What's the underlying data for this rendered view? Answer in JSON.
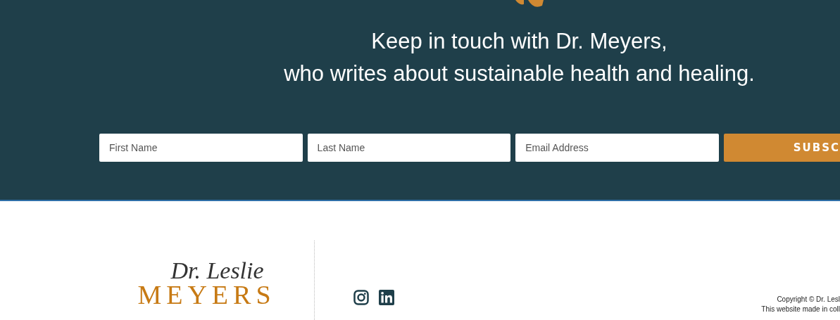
{
  "heading": {
    "lines": [
      "Keep in touch with Dr. Meyers,",
      "who writes about sustainable health and healing."
    ]
  },
  "form": {
    "fields": [
      {
        "placeholder": "First Name"
      },
      {
        "placeholder": "Last Name"
      },
      {
        "placeholder": "Email Address"
      }
    ],
    "button": "SUBSC"
  },
  "footer": {
    "logo": {
      "script": "Dr. Leslie",
      "name": "MEYERS"
    },
    "copyright": [
      "Copyright © Dr. Lesl",
      "This website made in coll"
    ]
  }
}
